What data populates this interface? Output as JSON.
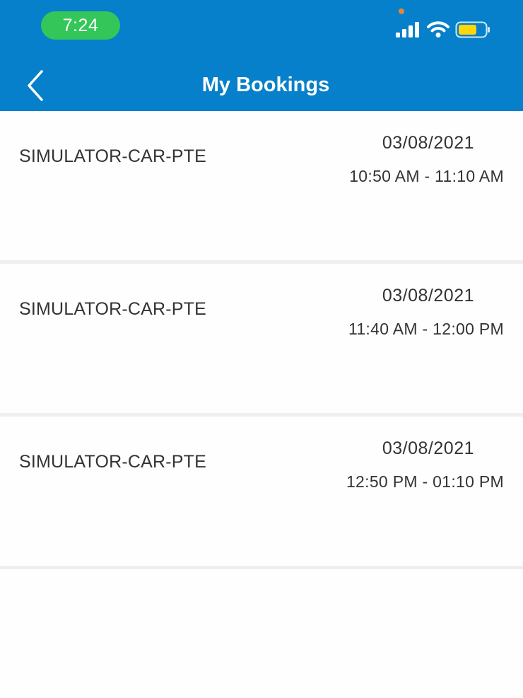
{
  "status_bar": {
    "time": "7:24"
  },
  "header": {
    "title": "My Bookings",
    "back_icon": "chevron-left-icon",
    "background_color": "#0680ca"
  },
  "bookings": [
    {
      "resource": "SIMULATOR-CAR-PTE",
      "date": "03/08/2021",
      "time": "10:50 AM - 11:10 AM"
    },
    {
      "resource": "SIMULATOR-CAR-PTE",
      "date": "03/08/2021",
      "time": "11:40 AM - 12:00 PM"
    },
    {
      "resource": "SIMULATOR-CAR-PTE",
      "date": "03/08/2021",
      "time": "12:50 PM - 01:10 PM"
    }
  ]
}
